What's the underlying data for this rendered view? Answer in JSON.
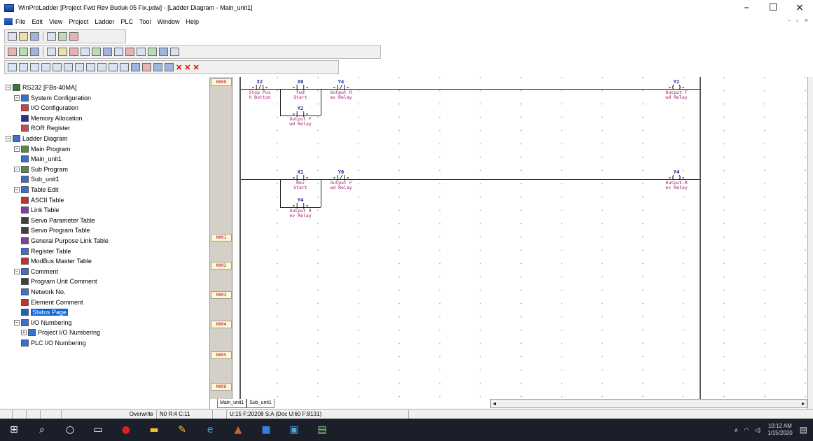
{
  "window": {
    "title": "WinProLadder [Project Fwd Rev Buduk 05 Fix.pdw] - [Ladder Diagram - Main_unit1]",
    "minimize": "–",
    "maximize": "☐",
    "close": "×",
    "mdi_controls": "- ▫ ×"
  },
  "menu": [
    "File",
    "Edit",
    "View",
    "Project",
    "Ladder",
    "PLC",
    "Tool",
    "Window",
    "Help"
  ],
  "tree": [
    {
      "label": "RS232 [FBs-40MA]",
      "expander": "−",
      "icon_color": "#2c7a2c"
    },
    {
      "label": "System Configuration",
      "expander": "−",
      "icon_color": "#3a6fd0"
    },
    {
      "label": "I/O Configuration",
      "expander": "",
      "icon_color": "#d04040"
    },
    {
      "label": "Memory Allocation",
      "expander": "",
      "icon_color": "#303090"
    },
    {
      "label": "ROR Register",
      "expander": "",
      "icon_color": "#c05050"
    },
    {
      "label": "Ladder Diagram",
      "expander": "−",
      "icon_color": "#3a6fd0"
    },
    {
      "label": "Main Program",
      "expander": "−",
      "icon_color": "#5a8a3a"
    },
    {
      "label": "Main_unit1",
      "expander": "",
      "icon_color": "#3a6fd0"
    },
    {
      "label": "Sub Program",
      "expander": "−",
      "icon_color": "#5a8a3a"
    },
    {
      "label": "Sub_unit1",
      "expander": "",
      "icon_color": "#3a6fd0"
    },
    {
      "label": "Table Edit",
      "expander": "−",
      "icon_color": "#3a6fd0"
    },
    {
      "label": "ASCII Table",
      "expander": "",
      "icon_color": "#c03030"
    },
    {
      "label": "Link Table",
      "expander": "",
      "icon_color": "#8040a0"
    },
    {
      "label": "Servo Parameter Table",
      "expander": "",
      "icon_color": "#404040"
    },
    {
      "label": "Servo Program Table",
      "expander": "",
      "icon_color": "#404040"
    },
    {
      "label": "General Purpose Link Table",
      "expander": "",
      "icon_color": "#8040a0"
    },
    {
      "label": "Register Table",
      "expander": "",
      "icon_color": "#3a6fd0"
    },
    {
      "label": "ModBus Master Table",
      "expander": "",
      "icon_color": "#c03030"
    },
    {
      "label": "Comment",
      "expander": "−",
      "icon_color": "#3a6fd0"
    },
    {
      "label": "Program Unit Comment",
      "expander": "",
      "icon_color": "#404040"
    },
    {
      "label": "Network No.",
      "expander": "",
      "icon_color": "#3a6fd0"
    },
    {
      "label": "Element Comment",
      "expander": "",
      "icon_color": "#c03030"
    },
    {
      "label": "Status Page",
      "expander": "",
      "icon_color": "#2060c0",
      "selected": true
    },
    {
      "label": "I/O Numbering",
      "expander": "−",
      "icon_color": "#3a6fd0"
    },
    {
      "label": "Project I/O Numbering",
      "expander": "+",
      "icon_color": "#3a6fd0"
    },
    {
      "label": "PLC I/O Numbering",
      "expander": "",
      "icon_color": "#3a6fd0"
    }
  ],
  "networks": [
    "N000",
    "N001",
    "N002",
    "N003",
    "N004",
    "N005",
    "N006"
  ],
  "ladder_elements": [
    {
      "addr": "X2",
      "sym": "-|/|-",
      "cmt1": "Stop Pus",
      "cmt2": "h Botton"
    },
    {
      "addr": "X0",
      "sym": "-| |-",
      "cmt1": "Fwd",
      "cmt2": "Start"
    },
    {
      "addr": "Y4",
      "sym": "-|/|-",
      "cmt1": "Output R",
      "cmt2": "ev Relay"
    },
    {
      "addr": "Y2",
      "sym": "-( )-",
      "cmt1": "Output F",
      "cmt2": "wd Relay"
    },
    {
      "addr": "Y2",
      "sym": "-| |-",
      "cmt1": "Output F",
      "cmt2": "wd Relay"
    },
    {
      "addr": "X1",
      "sym": "-| |-",
      "cmt1": "Rev",
      "cmt2": "Start"
    },
    {
      "addr": "Y0",
      "sym": "-|/|-",
      "cmt1": "Output F",
      "cmt2": "wd Relay"
    },
    {
      "addr": "Y4",
      "sym": "-( )-",
      "cmt1": "Output R",
      "cmt2": "ev Relay"
    },
    {
      "addr": "Y4",
      "sym": "-| |-",
      "cmt1": "Output R",
      "cmt2": "ev Relay"
    }
  ],
  "tabs": [
    "Main_unit1",
    "Sub_unit1"
  ],
  "status": {
    "mode": "Overwrite",
    "position": "N0 R:4 C:11",
    "memory": "U:15 F:20208 S:A (Doc U:60 F:8131)"
  },
  "taskbar": {
    "time": "10:12 AM",
    "date": "1/15/2020"
  }
}
